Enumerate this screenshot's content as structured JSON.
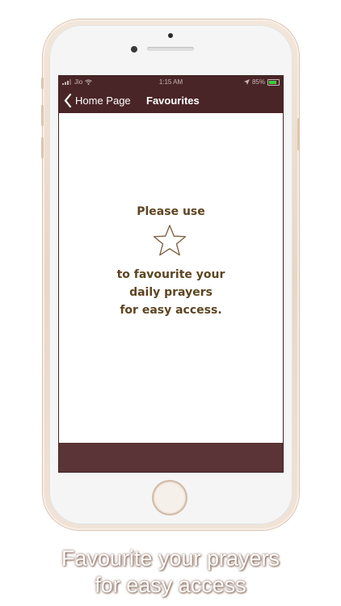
{
  "statusbar": {
    "carrier": "Jio",
    "time": "1:15 AM",
    "battery": "85%",
    "battery_level": 0.85
  },
  "navbar": {
    "back_label": "Home Page",
    "title": "Favourites"
  },
  "content": {
    "line_top": "Please use",
    "line_bottom": [
      "to favourite your",
      "daily prayers",
      "for easy access."
    ]
  },
  "caption": {
    "line1": "Favourite your prayers",
    "line2": "for easy access"
  },
  "icons": [
    "signal-icon",
    "wifi-icon",
    "location-icon",
    "battery-icon",
    "back-chevron-icon",
    "star-icon"
  ],
  "colors": {
    "bar": "#4a2527",
    "bottombar": "#5a3436",
    "text": "#5e4521",
    "battery": "#3ccf3c"
  }
}
